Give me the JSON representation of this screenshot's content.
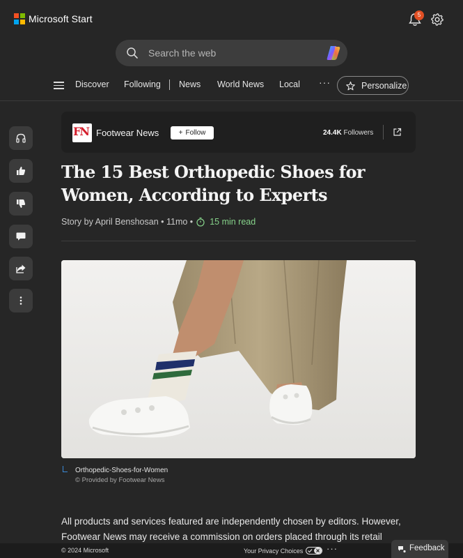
{
  "brand": {
    "name": "Microsoft Start",
    "logo_colors": [
      "#f25022",
      "#7fba00",
      "#00a4ef",
      "#ffb900"
    ]
  },
  "notifications": {
    "count": "5"
  },
  "search": {
    "placeholder": "Search the web"
  },
  "nav": {
    "items": [
      "Discover",
      "Following",
      "News",
      "World News",
      "Local"
    ],
    "more": "···",
    "personalize_label": "Personalize"
  },
  "rail": {
    "buttons": [
      "headphones-icon",
      "thumbs-up-icon",
      "thumbs-down-icon",
      "comment-icon",
      "share-icon",
      "more-vertical-icon"
    ]
  },
  "publisher": {
    "logo_text": "FN",
    "name": "Footwear News",
    "follow_label": "Follow",
    "followers_count": "24.4K",
    "followers_label": "Followers"
  },
  "article": {
    "title": "The 15 Best Orthopedic Shoes for Women, According to Experts",
    "byline": "Story by April Benshosan • 11mo •",
    "read_time": "15 min read",
    "image_caption": "Orthopedic-Shoes-for-Women",
    "image_credit": "© Provided by Footwear News",
    "body": "All products and services featured are independently chosen by editors. However, Footwear News may receive a commission on orders placed through its retail"
  },
  "footer": {
    "copyright": "© 2024 Microsoft",
    "privacy": "Your Privacy Choices",
    "more": "···",
    "feedback": "Feedback"
  },
  "colors": {
    "accent_green": "#86d28a",
    "badge": "#e14f24",
    "fn_red": "#d41e2c"
  }
}
